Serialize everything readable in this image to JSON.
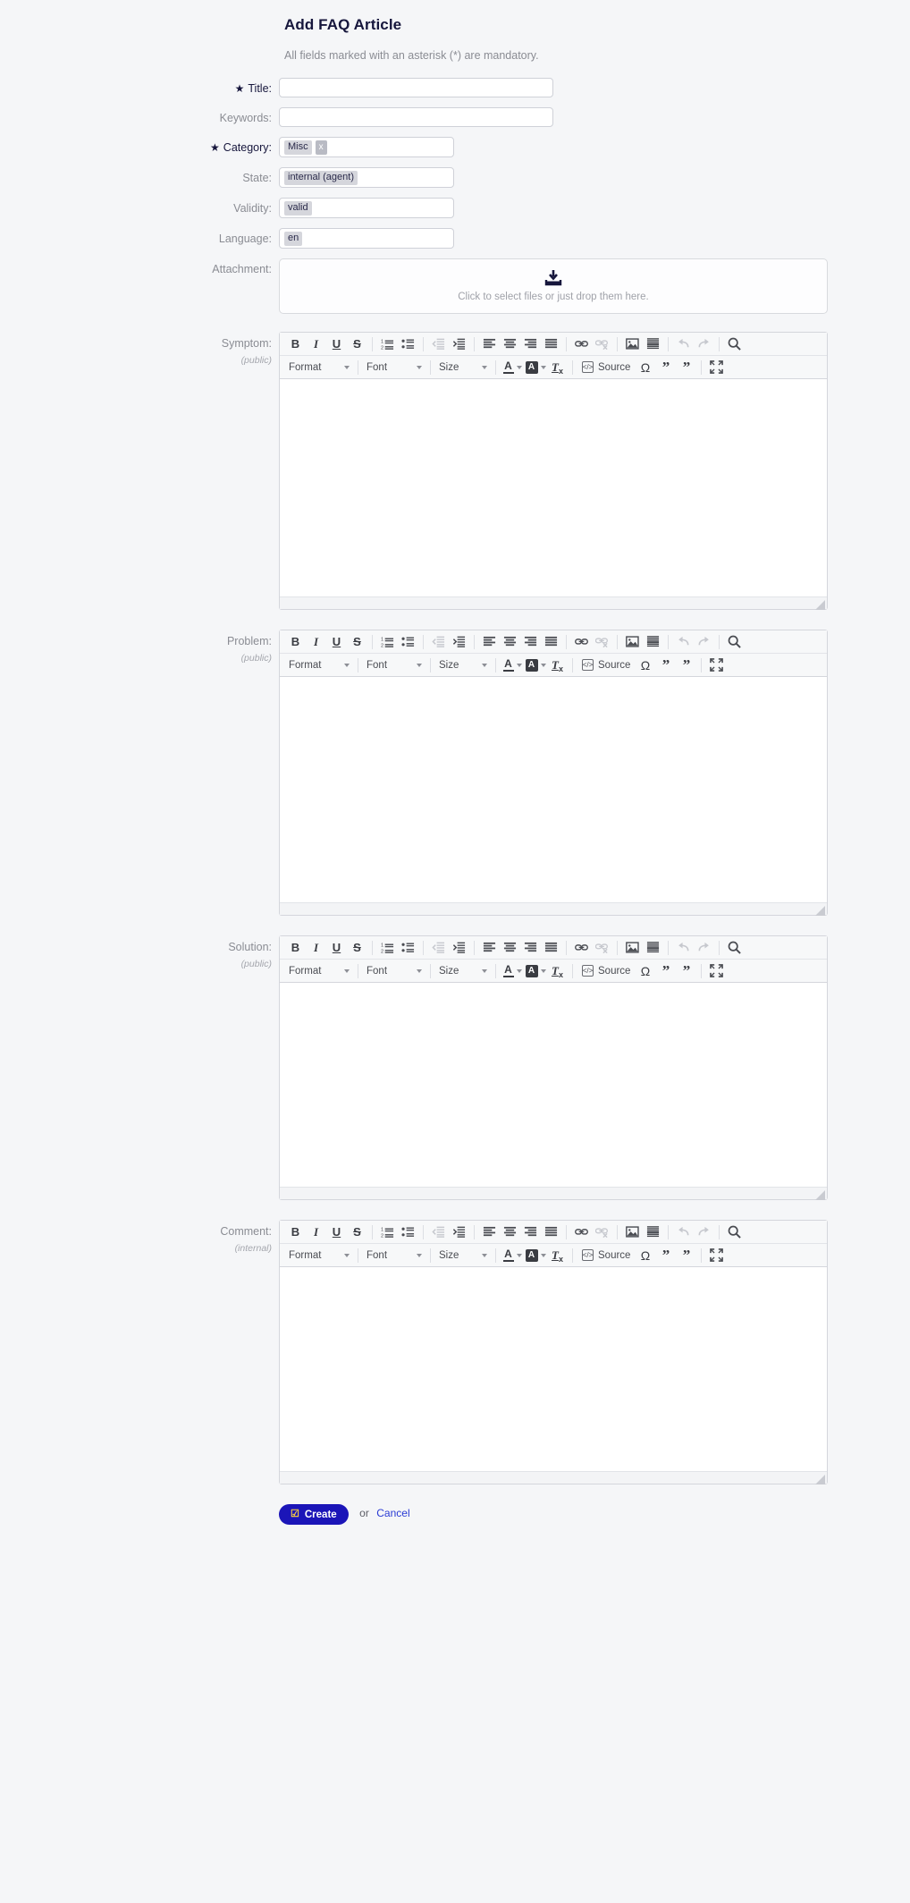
{
  "header": {
    "title": "Add FAQ Article",
    "mandatory_note": "All fields marked with an asterisk (*) are mandatory."
  },
  "fields": {
    "title": {
      "label": "Title:",
      "required": true,
      "value": "",
      "placeholder": ""
    },
    "keywords": {
      "label": "Keywords:",
      "required": false,
      "value": "",
      "placeholder": ""
    },
    "category": {
      "label": "Category:",
      "required": true,
      "selected": "Misc",
      "remove_label": "x"
    },
    "state": {
      "label": "State:",
      "required": false,
      "selected": "internal (agent)"
    },
    "validity": {
      "label": "Validity:",
      "required": false,
      "selected": "valid"
    },
    "language": {
      "label": "Language:",
      "required": false,
      "selected": "en"
    },
    "attachment": {
      "label": "Attachment:",
      "dropzone_text": "Click to select files or just drop them here.",
      "icon": "download-tray-icon"
    }
  },
  "editors": [
    {
      "label": "Symptom:",
      "visibility": "(public)",
      "value": ""
    },
    {
      "label": "Problem:",
      "visibility": "(public)",
      "value": ""
    },
    {
      "label": "Solution:",
      "visibility": "(public)",
      "value": ""
    },
    {
      "label": "Comment:",
      "visibility": "(internal)",
      "value": ""
    }
  ],
  "toolbar": {
    "row1": [
      {
        "name": "bold-icon",
        "glyph": "B",
        "style": "bold",
        "disabled": false
      },
      {
        "name": "italic-icon",
        "glyph": "I",
        "style": "italic",
        "disabled": false
      },
      {
        "name": "underline-icon",
        "glyph": "U",
        "style": "underline",
        "disabled": false
      },
      {
        "name": "strikethrough-icon",
        "glyph": "S",
        "style": "strike",
        "disabled": false
      },
      {
        "name": "separator",
        "glyph": "",
        "style": "sep",
        "disabled": false
      },
      {
        "name": "numbered-list-icon",
        "glyph": "",
        "style": "ol",
        "disabled": false
      },
      {
        "name": "bulleted-list-icon",
        "glyph": "",
        "style": "ul",
        "disabled": false
      },
      {
        "name": "separator",
        "glyph": "",
        "style": "sep",
        "disabled": false
      },
      {
        "name": "decrease-indent-icon",
        "glyph": "",
        "style": "outdent",
        "disabled": true
      },
      {
        "name": "increase-indent-icon",
        "glyph": "",
        "style": "indent",
        "disabled": false
      },
      {
        "name": "separator",
        "glyph": "",
        "style": "sep",
        "disabled": false
      },
      {
        "name": "align-left-icon",
        "glyph": "",
        "style": "alignleft",
        "disabled": false
      },
      {
        "name": "align-center-icon",
        "glyph": "",
        "style": "aligncenter",
        "disabled": false
      },
      {
        "name": "align-right-icon",
        "glyph": "",
        "style": "alignright",
        "disabled": false
      },
      {
        "name": "align-justify-icon",
        "glyph": "",
        "style": "alignjustify",
        "disabled": false
      },
      {
        "name": "separator",
        "glyph": "",
        "style": "sep",
        "disabled": false
      },
      {
        "name": "link-icon",
        "glyph": "",
        "style": "link",
        "disabled": false
      },
      {
        "name": "unlink-icon",
        "glyph": "",
        "style": "unlink",
        "disabled": true
      },
      {
        "name": "separator",
        "glyph": "",
        "style": "sep",
        "disabled": false
      },
      {
        "name": "image-icon",
        "glyph": "",
        "style": "image",
        "disabled": false
      },
      {
        "name": "horizontal-rule-icon",
        "glyph": "",
        "style": "hrule",
        "disabled": false
      },
      {
        "name": "separator",
        "glyph": "",
        "style": "sep",
        "disabled": false
      },
      {
        "name": "undo-icon",
        "glyph": "",
        "style": "undo",
        "disabled": true
      },
      {
        "name": "redo-icon",
        "glyph": "",
        "style": "redo",
        "disabled": true
      },
      {
        "name": "separator",
        "glyph": "",
        "style": "sep",
        "disabled": false
      },
      {
        "name": "find-icon",
        "glyph": "",
        "style": "find",
        "disabled": false
      }
    ],
    "format_label": "Format",
    "font_label": "Font",
    "size_label": "Size",
    "text_color_label": "A",
    "bg_color_label": "A",
    "remove_format_label": "Tx",
    "source_label": "Source",
    "special_char_label": "Ω",
    "blockquote_label": "\"",
    "maximize_label": "maximize"
  },
  "submit": {
    "create_label": "Create",
    "or_label": "or",
    "cancel_label": "Cancel",
    "accent_color": "#1b15b8",
    "check_color": "#ffd33d",
    "cancel_color": "#2a3bd4"
  }
}
